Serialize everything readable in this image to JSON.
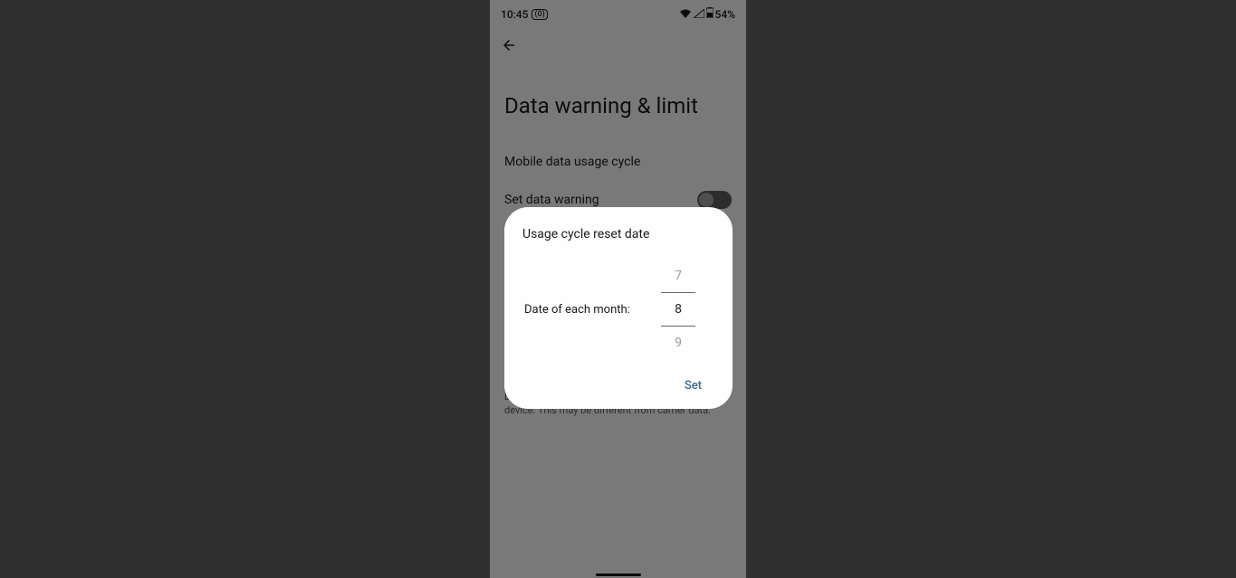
{
  "status": {
    "time": "10:45",
    "notification_badge": "(0)",
    "battery": "54%"
  },
  "page": {
    "title": "Data warning & limit",
    "settings": {
      "mobile_cycle": "Mobile data usage cycle",
      "set_warning": "Set data warning"
    },
    "footer": "Data warning and data limit are measured by your device. This may be different from carrier data."
  },
  "dialog": {
    "title": "Usage cycle reset date",
    "picker_label": "Date of each month:",
    "picker": {
      "prev": "7",
      "current": "8",
      "next": "9"
    },
    "set_button": "Set"
  }
}
